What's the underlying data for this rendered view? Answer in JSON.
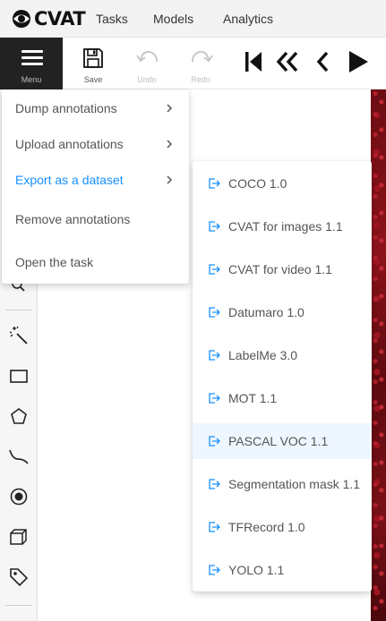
{
  "app": {
    "logo_text": "CVAT"
  },
  "nav": {
    "items": [
      "Tasks",
      "Models",
      "Analytics"
    ]
  },
  "toolbar": {
    "menu_label": "Menu",
    "save_label": "Save",
    "undo_label": "Undo",
    "redo_label": "Redo"
  },
  "menu": {
    "items": [
      {
        "label": "Dump annotations",
        "has_submenu": true
      },
      {
        "label": "Upload annotations",
        "has_submenu": true
      },
      {
        "label": "Export as a dataset",
        "has_submenu": true,
        "active": true
      },
      {
        "label": "Remove annotations",
        "has_submenu": false
      },
      {
        "label": "Open the task",
        "has_submenu": false
      }
    ]
  },
  "export_submenu": {
    "items": [
      {
        "label": "COCO 1.0"
      },
      {
        "label": "CVAT for images 1.1"
      },
      {
        "label": "CVAT for video 1.1"
      },
      {
        "label": "Datumaro 1.0"
      },
      {
        "label": "LabelMe 3.0"
      },
      {
        "label": "MOT 1.1"
      },
      {
        "label": "PASCAL VOC 1.1",
        "hovered": true
      },
      {
        "label": "Segmentation mask 1.1"
      },
      {
        "label": "TFRecord 1.0"
      },
      {
        "label": "YOLO 1.1"
      }
    ]
  },
  "colors": {
    "accent": "#1890ff",
    "menu_bg": "#222222",
    "hover_bg": "#eef6ff",
    "icon_blue": "#1890ff"
  }
}
